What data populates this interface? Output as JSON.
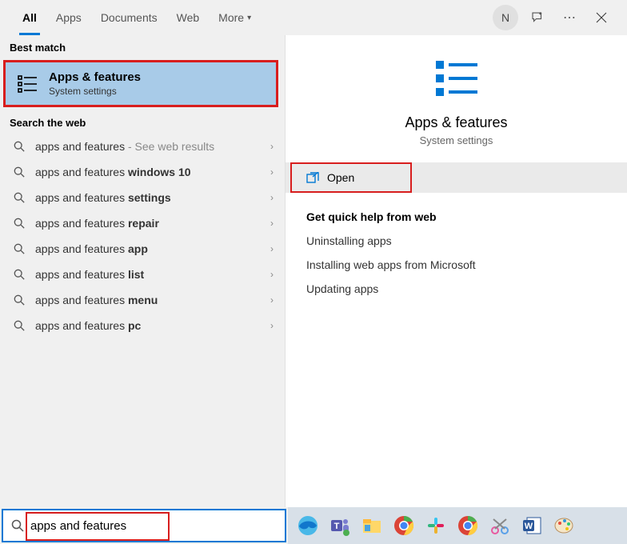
{
  "tabs": {
    "all": "All",
    "apps": "Apps",
    "documents": "Documents",
    "web": "Web",
    "more": "More"
  },
  "avatar_letter": "N",
  "sections": {
    "best_match": "Best match",
    "search_web": "Search the web"
  },
  "best_match": {
    "title": "Apps & features",
    "subtitle": "System settings"
  },
  "web_results": [
    {
      "prefix": "apps and features",
      "bold": "",
      "suffix": " - See web results"
    },
    {
      "prefix": "apps and features ",
      "bold": "windows 10",
      "suffix": ""
    },
    {
      "prefix": "apps and features ",
      "bold": "settings",
      "suffix": ""
    },
    {
      "prefix": "apps and features ",
      "bold": "repair",
      "suffix": ""
    },
    {
      "prefix": "apps and features ",
      "bold": "app",
      "suffix": ""
    },
    {
      "prefix": "apps and features ",
      "bold": "list",
      "suffix": ""
    },
    {
      "prefix": "apps and features ",
      "bold": "menu",
      "suffix": ""
    },
    {
      "prefix": "apps and features ",
      "bold": "pc",
      "suffix": ""
    }
  ],
  "detail": {
    "title": "Apps & features",
    "subtitle": "System settings",
    "open": "Open"
  },
  "help": {
    "header": "Get quick help from web",
    "items": [
      "Uninstalling apps",
      "Installing web apps from Microsoft",
      "Updating apps"
    ]
  },
  "search_value": "apps and features",
  "taskbar_icons": [
    "edge",
    "teams",
    "explorer",
    "chrome",
    "slack",
    "chrome2",
    "snip",
    "word",
    "paint"
  ]
}
